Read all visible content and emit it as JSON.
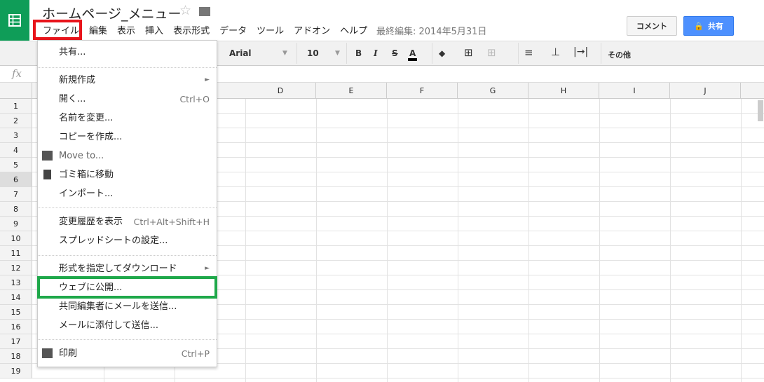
{
  "app": {
    "title": "ホームページ_メニュー",
    "last_edit": "最終編集: 2014年5月31日",
    "icons": [
      "sheets-logo-icon",
      "star-icon",
      "folder-icon"
    ]
  },
  "menubar": [
    "ファイル",
    "編集",
    "表示",
    "挿入",
    "表示形式",
    "データ",
    "ツール",
    "アドオン",
    "ヘルプ"
  ],
  "buttons": {
    "comment": "コメント",
    "share": "共有"
  },
  "toolbar": {
    "font": "Arial",
    "size": "10",
    "bold": "B",
    "italic": "I",
    "strike": "S",
    "color": "A",
    "more": "その他"
  },
  "formula_bar": {
    "fx": "fx"
  },
  "columns": [
    "D",
    "E",
    "F",
    "G",
    "H",
    "I",
    "J"
  ],
  "rows": [
    "1",
    "2",
    "3",
    "4",
    "5",
    "6",
    "7",
    "8",
    "9",
    "10",
    "11",
    "12",
    "13",
    "14",
    "15",
    "16",
    "17",
    "18",
    "19"
  ],
  "file_menu": {
    "items": [
      {
        "label": "共有...",
        "shortcut": ""
      },
      {
        "label": "新規作成",
        "shortcut": "►"
      },
      {
        "label": "開く...",
        "shortcut": "Ctrl+O"
      },
      {
        "label": "名前を変更...",
        "shortcut": ""
      },
      {
        "label": "コピーを作成...",
        "shortcut": ""
      },
      {
        "label": "Move to...",
        "shortcut": ""
      },
      {
        "label": "ゴミ箱に移動",
        "shortcut": ""
      },
      {
        "label": "インポート...",
        "shortcut": ""
      },
      {
        "label": "変更履歴を表示",
        "shortcut": "Ctrl+Alt+Shift+H"
      },
      {
        "label": "スプレッドシートの設定...",
        "shortcut": ""
      },
      {
        "label": "形式を指定してダウンロード",
        "shortcut": "►"
      },
      {
        "label": "ウェブに公開...",
        "shortcut": ""
      },
      {
        "label": "共同編集者にメールを送信...",
        "shortcut": ""
      },
      {
        "label": "メールに添付して送信...",
        "shortcut": ""
      },
      {
        "label": "印刷",
        "shortcut": "Ctrl+P"
      }
    ]
  },
  "colors": {
    "highlight_red": "#e8141b",
    "highlight_green": "#1fa84a",
    "share_blue": "#4d90fe",
    "brand_green": "#0f9d58"
  }
}
